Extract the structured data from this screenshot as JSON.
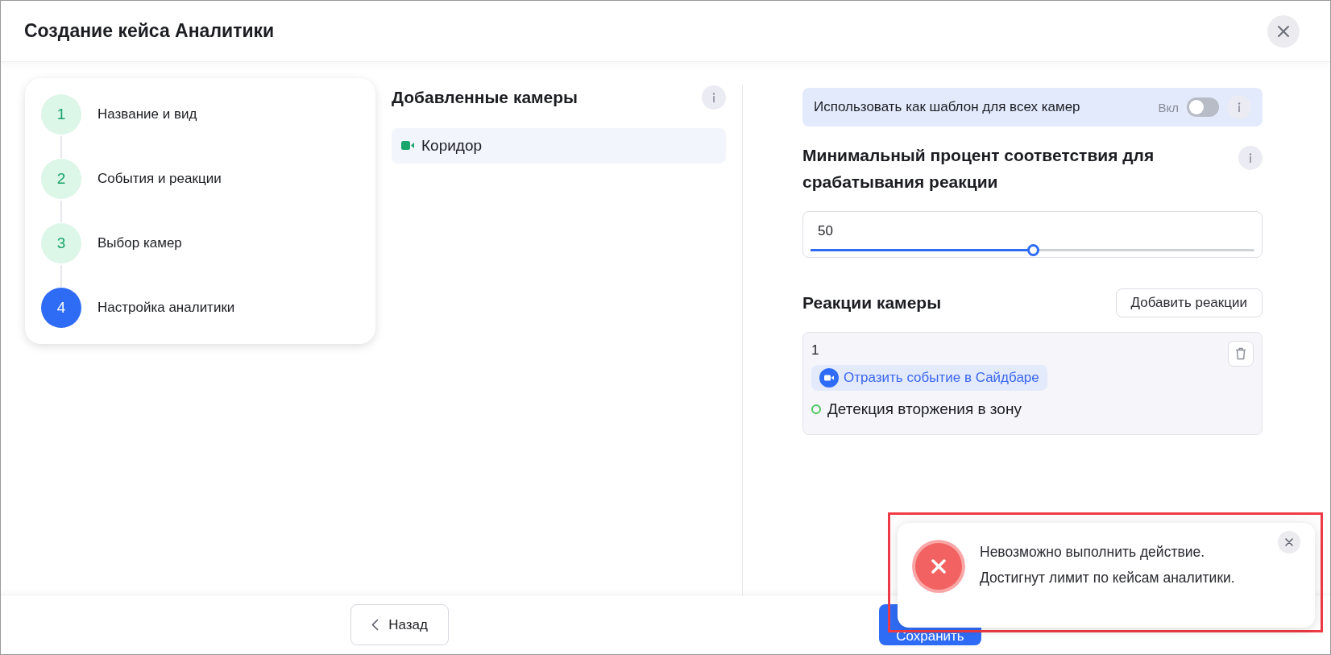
{
  "window": {
    "title": "Создание кейса Аналитики"
  },
  "steps": [
    {
      "number": "1",
      "label": "Название и вид",
      "selected": false
    },
    {
      "number": "2",
      "label": "События и реакции",
      "selected": false
    },
    {
      "number": "3",
      "label": "Выбор камер",
      "selected": false
    },
    {
      "number": "4",
      "label": "Настройка аналитики",
      "selected": true
    }
  ],
  "cameras": {
    "title": "Добавленные камеры",
    "items": [
      {
        "name": "Коридор"
      }
    ]
  },
  "template": {
    "label": "Использовать как шаблон для всех камер",
    "state_label": "Вкл",
    "on": false
  },
  "threshold": {
    "title": "Минимальный процент соответствия для срабатывания реакции",
    "value": "50",
    "level": 0.5
  },
  "reactions": {
    "title": "Реакции камеры",
    "add_button": "Добавить реакции",
    "items": [
      {
        "number": "1",
        "action": "Отразить событие в Сайдбаре",
        "event": "Детекция вторжения в зону"
      }
    ]
  },
  "footer": {
    "back": "Назад",
    "save": "Сохранить"
  },
  "toast": {
    "message": "Невозможно выполнить действие. Достигнут лимит по кейсам аналитики."
  }
}
